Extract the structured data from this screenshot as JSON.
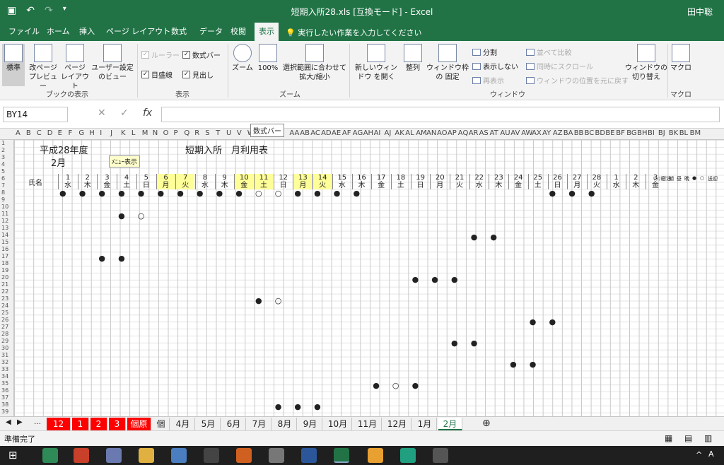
{
  "window": {
    "title": "短期入所28.xls [互換モード] - Excel",
    "user": "田中聡"
  },
  "menu": {
    "tabs": [
      "ファイル",
      "ホーム",
      "挿入",
      "ページ レイアウト",
      "数式",
      "データ",
      "校閲",
      "表示"
    ],
    "active": "表示",
    "tell": "実行したい作業を入力してください"
  },
  "ribbon": {
    "views": {
      "normal": "標準",
      "pagebreak": "改ページ プレビュー",
      "pagelayout": "ページ レイアウト",
      "custom": "ユーザー設定 のビュー",
      "group": "ブックの表示"
    },
    "show": {
      "ruler": "ルーラー",
      "formula_bar": "数式バー",
      "gridlines": "目盛線",
      "headings": "見出し",
      "group": "表示"
    },
    "zoom": {
      "zoom": "ズーム",
      "hundred": "100%",
      "selection": "選択範囲に合わせて 拡大/縮小",
      "group": "ズーム"
    },
    "window": {
      "new": "新しいウィンドウ を開く",
      "arrange": "整列",
      "freeze": "ウィンドウ枠の 固定",
      "split": "分割",
      "hide": "表示しない",
      "unhide": "再表示",
      "side": "並べて比較",
      "sync": "同時にスクロール",
      "reset": "ウィンドウの位置を元に戻す",
      "switch": "ウィンドウの 切り替え",
      "group": "ウィンドウ"
    },
    "macro": {
      "label": "マクロ",
      "group": "マクロ"
    }
  },
  "formula_bar": {
    "namebox": "BY14",
    "fx": "fx",
    "value": ""
  },
  "tooltip": "数式バー",
  "columns": [
    "A",
    "B",
    "C",
    "D",
    "E",
    "F",
    "G",
    "H",
    "I",
    "J",
    "K",
    "L",
    "M",
    "N",
    "O",
    "P",
    "Q",
    "R",
    "S",
    "T",
    "U",
    "V",
    "W",
    "X",
    "Y",
    "Z",
    "AA",
    "AB",
    "AC",
    "AD",
    "AE",
    "AF",
    "AG",
    "AH",
    "AI",
    "AJ",
    "AK",
    "AL",
    "AM",
    "AN",
    "AO",
    "AP",
    "AQ",
    "AR",
    "AS",
    "AT",
    "AU",
    "AV",
    "AW",
    "AX",
    "AY",
    "AZ",
    "BA",
    "BB",
    "BC",
    "BD",
    "BE",
    "BF",
    "BG",
    "BH",
    "BI",
    "BJ",
    "BK",
    "BL",
    "BM"
  ],
  "sheet": {
    "year": "平成28年度",
    "month": "2月",
    "title": "短期入所　月利用表",
    "memo": "ﾒﾆｭｰ表示",
    "name_header": "氏名",
    "days": [
      {
        "d": "1",
        "w": "水"
      },
      {
        "d": "2",
        "w": "木"
      },
      {
        "d": "3",
        "w": "金"
      },
      {
        "d": "4",
        "w": "土"
      },
      {
        "d": "5",
        "w": "日"
      },
      {
        "d": "6",
        "w": "月",
        "hl": true
      },
      {
        "d": "7",
        "w": "火",
        "hl": true
      },
      {
        "d": "8",
        "w": "水"
      },
      {
        "d": "9",
        "w": "木"
      },
      {
        "d": "10",
        "w": "金",
        "hl": true
      },
      {
        "d": "11",
        "w": "土",
        "hl": true
      },
      {
        "d": "12",
        "w": "日"
      },
      {
        "d": "13",
        "w": "月",
        "hl": true
      },
      {
        "d": "14",
        "w": "火",
        "hl": true
      },
      {
        "d": "15",
        "w": "水"
      },
      {
        "d": "16",
        "w": "木"
      },
      {
        "d": "17",
        "w": "金"
      },
      {
        "d": "18",
        "w": "土"
      },
      {
        "d": "19",
        "w": "日"
      },
      {
        "d": "20",
        "w": "月"
      },
      {
        "d": "21",
        "w": "火"
      },
      {
        "d": "22",
        "w": "水"
      },
      {
        "d": "23",
        "w": "木"
      },
      {
        "d": "24",
        "w": "金"
      },
      {
        "d": "25",
        "w": "土"
      },
      {
        "d": "26",
        "w": "日"
      },
      {
        "d": "27",
        "w": "月"
      },
      {
        "d": "28",
        "w": "火"
      },
      {
        "d": "1",
        "w": "水"
      },
      {
        "d": "2",
        "w": "木"
      },
      {
        "d": "3",
        "w": "金"
      }
    ],
    "summary_headers": [
      "ﾘｯﾌﾄ",
      "宿泊",
      "朝",
      "昼",
      "晩",
      "●",
      "○",
      "送迎"
    ]
  },
  "sheet_tabs": [
    "12",
    "1",
    "2",
    "3",
    "個原",
    "個",
    "4月",
    "5月",
    "6月",
    "7月",
    "8月",
    "9月",
    "10月",
    "11月",
    "12月",
    "1月",
    "2月"
  ],
  "sheet_tabs_red": [
    "12",
    "1",
    "2",
    "3",
    "個原"
  ],
  "active_sheet": "2月",
  "status": "準備完了"
}
